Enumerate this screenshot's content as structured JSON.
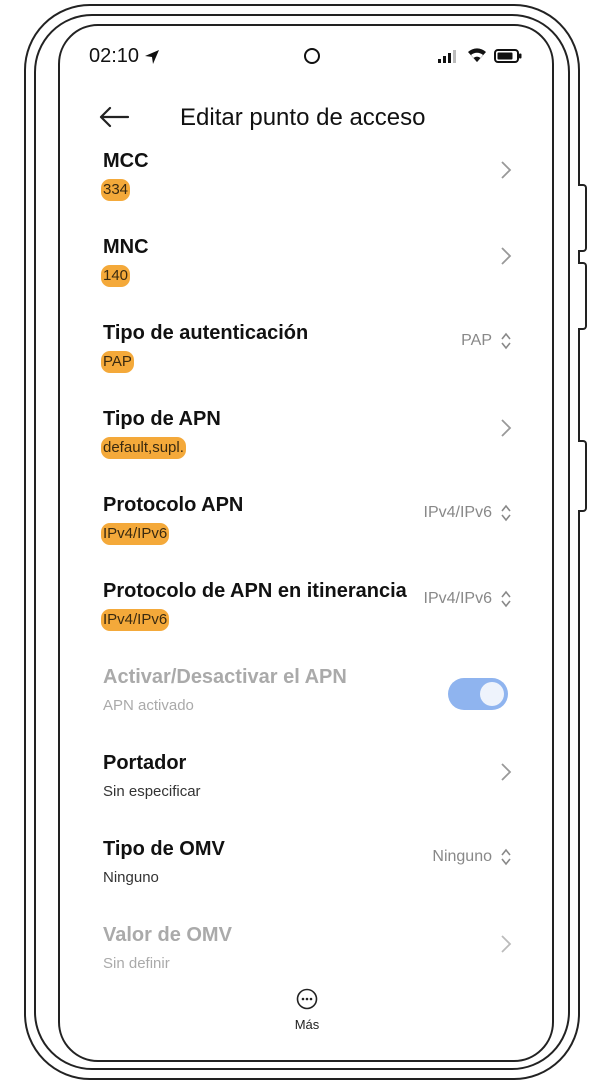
{
  "status_bar": {
    "time": "02:10"
  },
  "header": {
    "title": "Editar punto de acceso"
  },
  "rows": [
    {
      "title": "MCC",
      "subtitle": "334",
      "control": "chevron",
      "highlighted": true
    },
    {
      "title": "MNC",
      "subtitle": "140",
      "control": "chevron",
      "highlighted": true
    },
    {
      "title": "Tipo de autenticación",
      "subtitle": "PAP",
      "value": "PAP",
      "control": "select",
      "highlighted": true
    },
    {
      "title": "Tipo de APN",
      "subtitle": "default,supl.",
      "control": "chevron",
      "highlighted": true
    },
    {
      "title": "Protocolo APN",
      "subtitle": "IPv4/IPv6",
      "value": "IPv4/IPv6",
      "control": "select",
      "highlighted": true
    },
    {
      "title": "Protocolo de APN en itinerancia",
      "subtitle": "IPv4/IPv6",
      "value": "IPv4/IPv6",
      "control": "select",
      "highlighted": true
    },
    {
      "title": "Activar/Desactivar el APN",
      "subtitle": "APN activado",
      "control": "toggle",
      "toggle_on": true,
      "disabled": true
    },
    {
      "title": "Portador",
      "subtitle": "Sin especificar",
      "control": "chevron"
    },
    {
      "title": "Tipo de OMV",
      "subtitle": "Ninguno",
      "value": "Ninguno",
      "control": "select"
    },
    {
      "title": "Valor de OMV",
      "subtitle": "Sin definir",
      "control": "chevron",
      "disabled": true
    }
  ],
  "bottom": {
    "more_label": "Más"
  },
  "colors": {
    "highlight": "#f4a93a",
    "toggle_on": "#8fb4ef",
    "disabled_text": "#aaaaaa"
  }
}
